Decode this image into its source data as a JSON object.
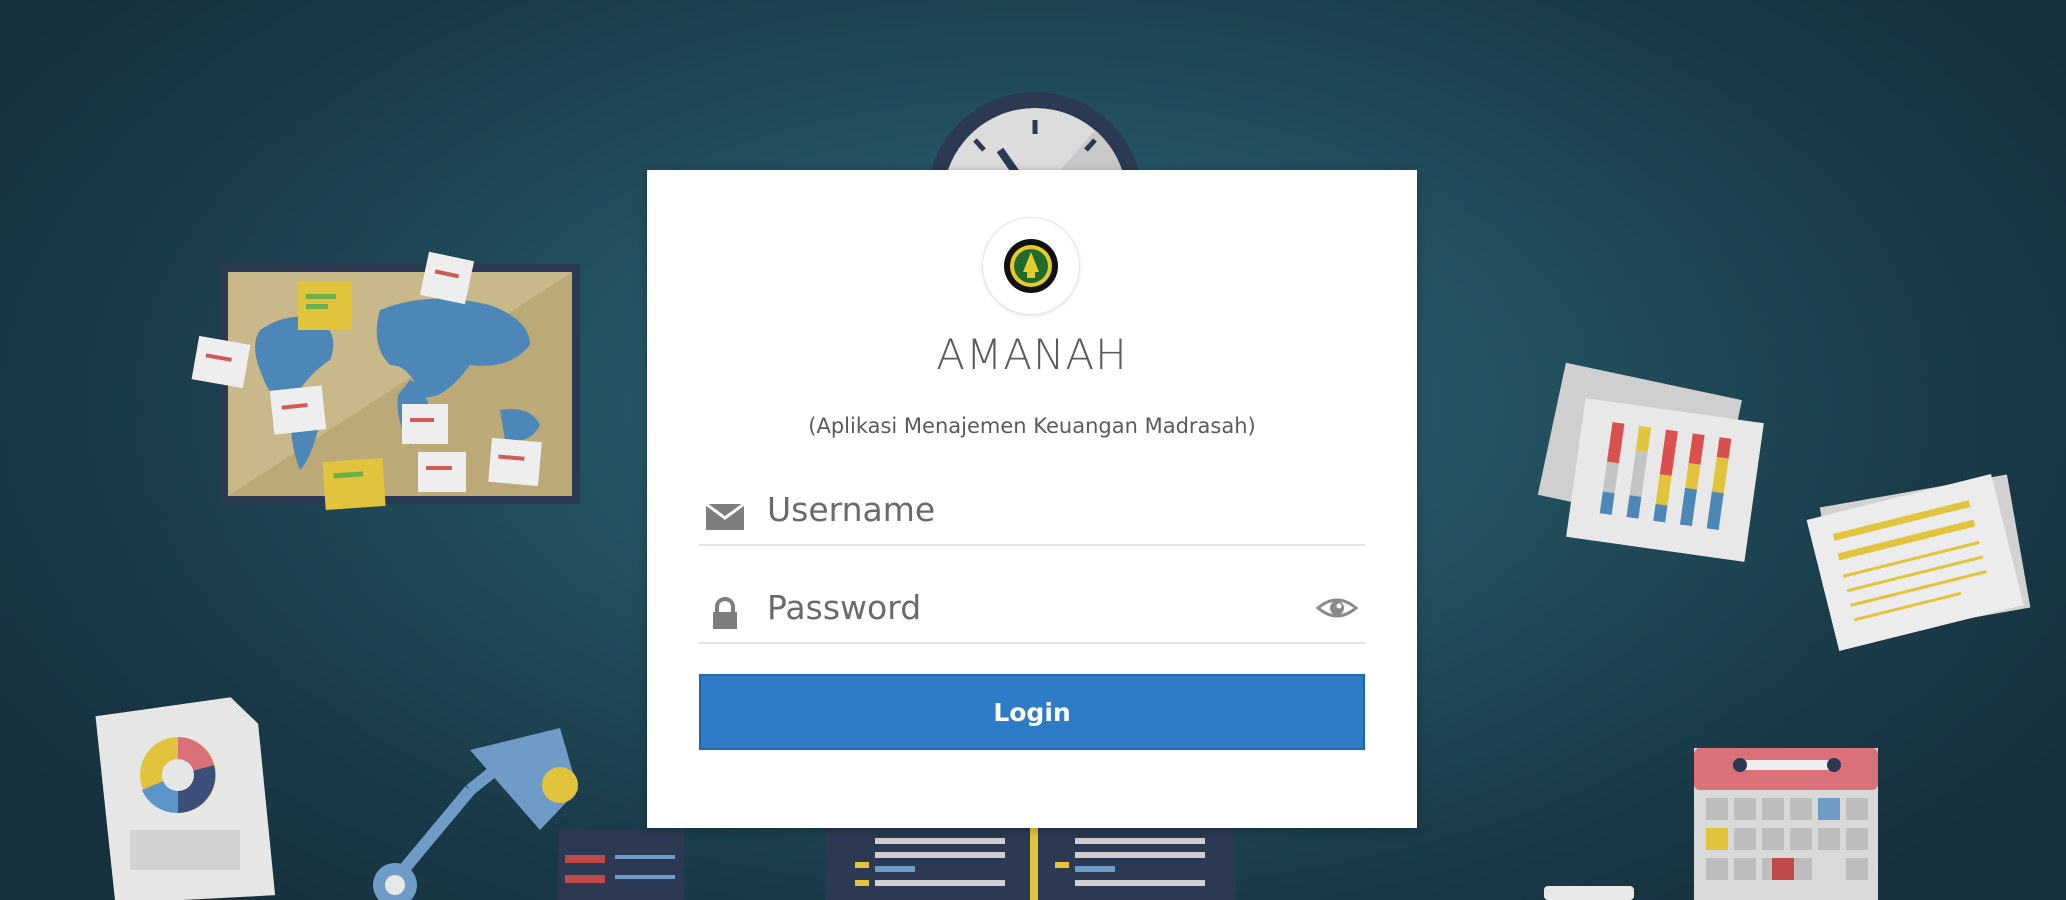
{
  "app": {
    "title": "AMANAH",
    "subtitle": "(Aplikasi Menajemen Keuangan Madrasah)"
  },
  "form": {
    "username_placeholder": "Username",
    "username_value": "",
    "password_placeholder": "Password",
    "password_value": "",
    "login_label": "Login"
  },
  "icons": {
    "username": "envelope-icon",
    "password": "lock-icon",
    "toggle_password": "eye-icon",
    "logo": "madrasah-emblem-icon"
  },
  "colors": {
    "background": "#22505f",
    "card": "#ffffff",
    "button": "#2e7bc6",
    "title": "#5b5b5b"
  }
}
